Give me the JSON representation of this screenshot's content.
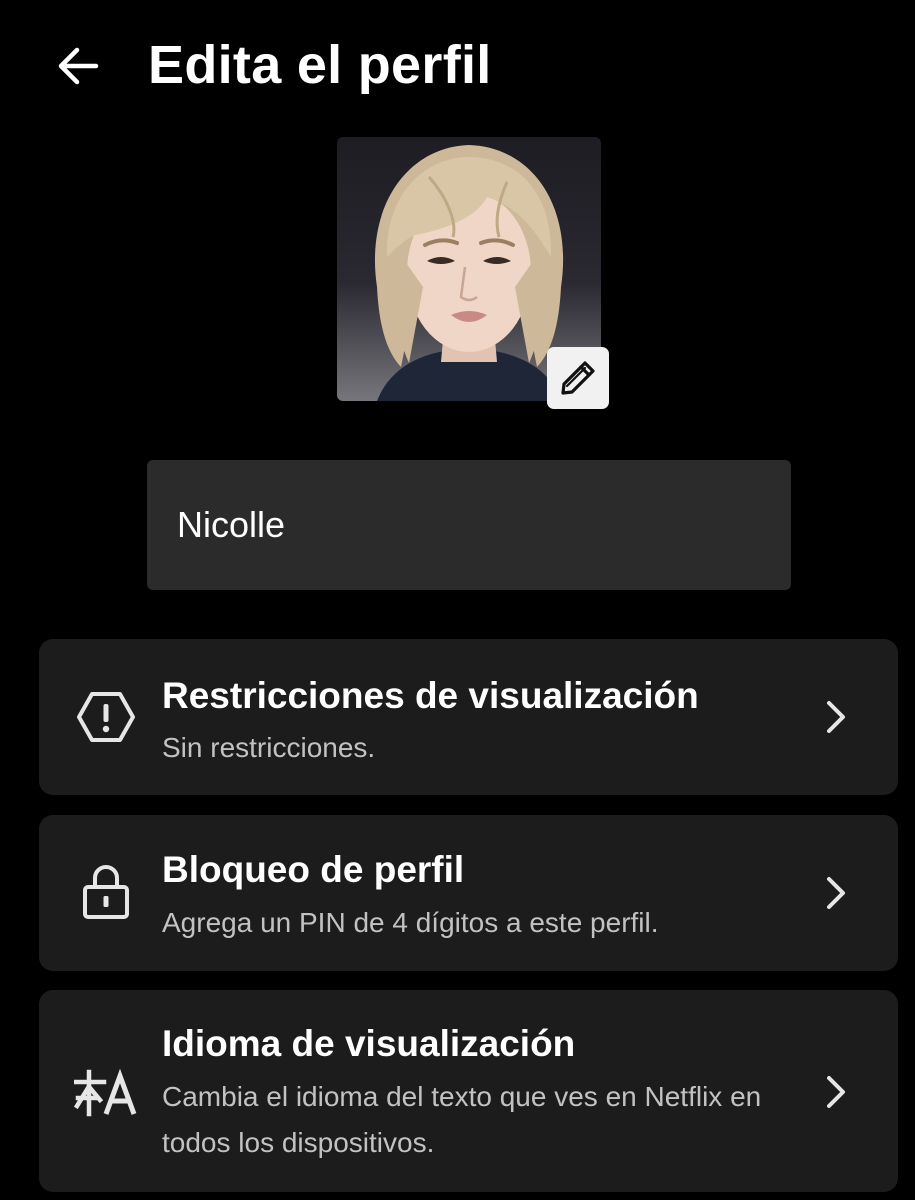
{
  "header": {
    "title": "Edita el perfil"
  },
  "profile": {
    "name_value": "Nicolle"
  },
  "settings": [
    {
      "title": "Restricciones de visualización",
      "subtitle": "Sin restricciones.",
      "icon": "warning-hexagon-icon"
    },
    {
      "title": "Bloqueo de perfil",
      "subtitle": "Agrega un PIN de 4 dígitos a este perfil.",
      "icon": "lock-icon"
    },
    {
      "title": "Idioma de visualización",
      "subtitle": "Cambia el idioma del texto que ves en Netflix en todos los dispositivos.",
      "icon": "translate-icon"
    }
  ],
  "colors": {
    "background": "#000000",
    "card": "#1c1c1c",
    "input": "#2b2b2b",
    "text_primary": "#ffffff",
    "text_secondary": "#c2c2c2"
  }
}
